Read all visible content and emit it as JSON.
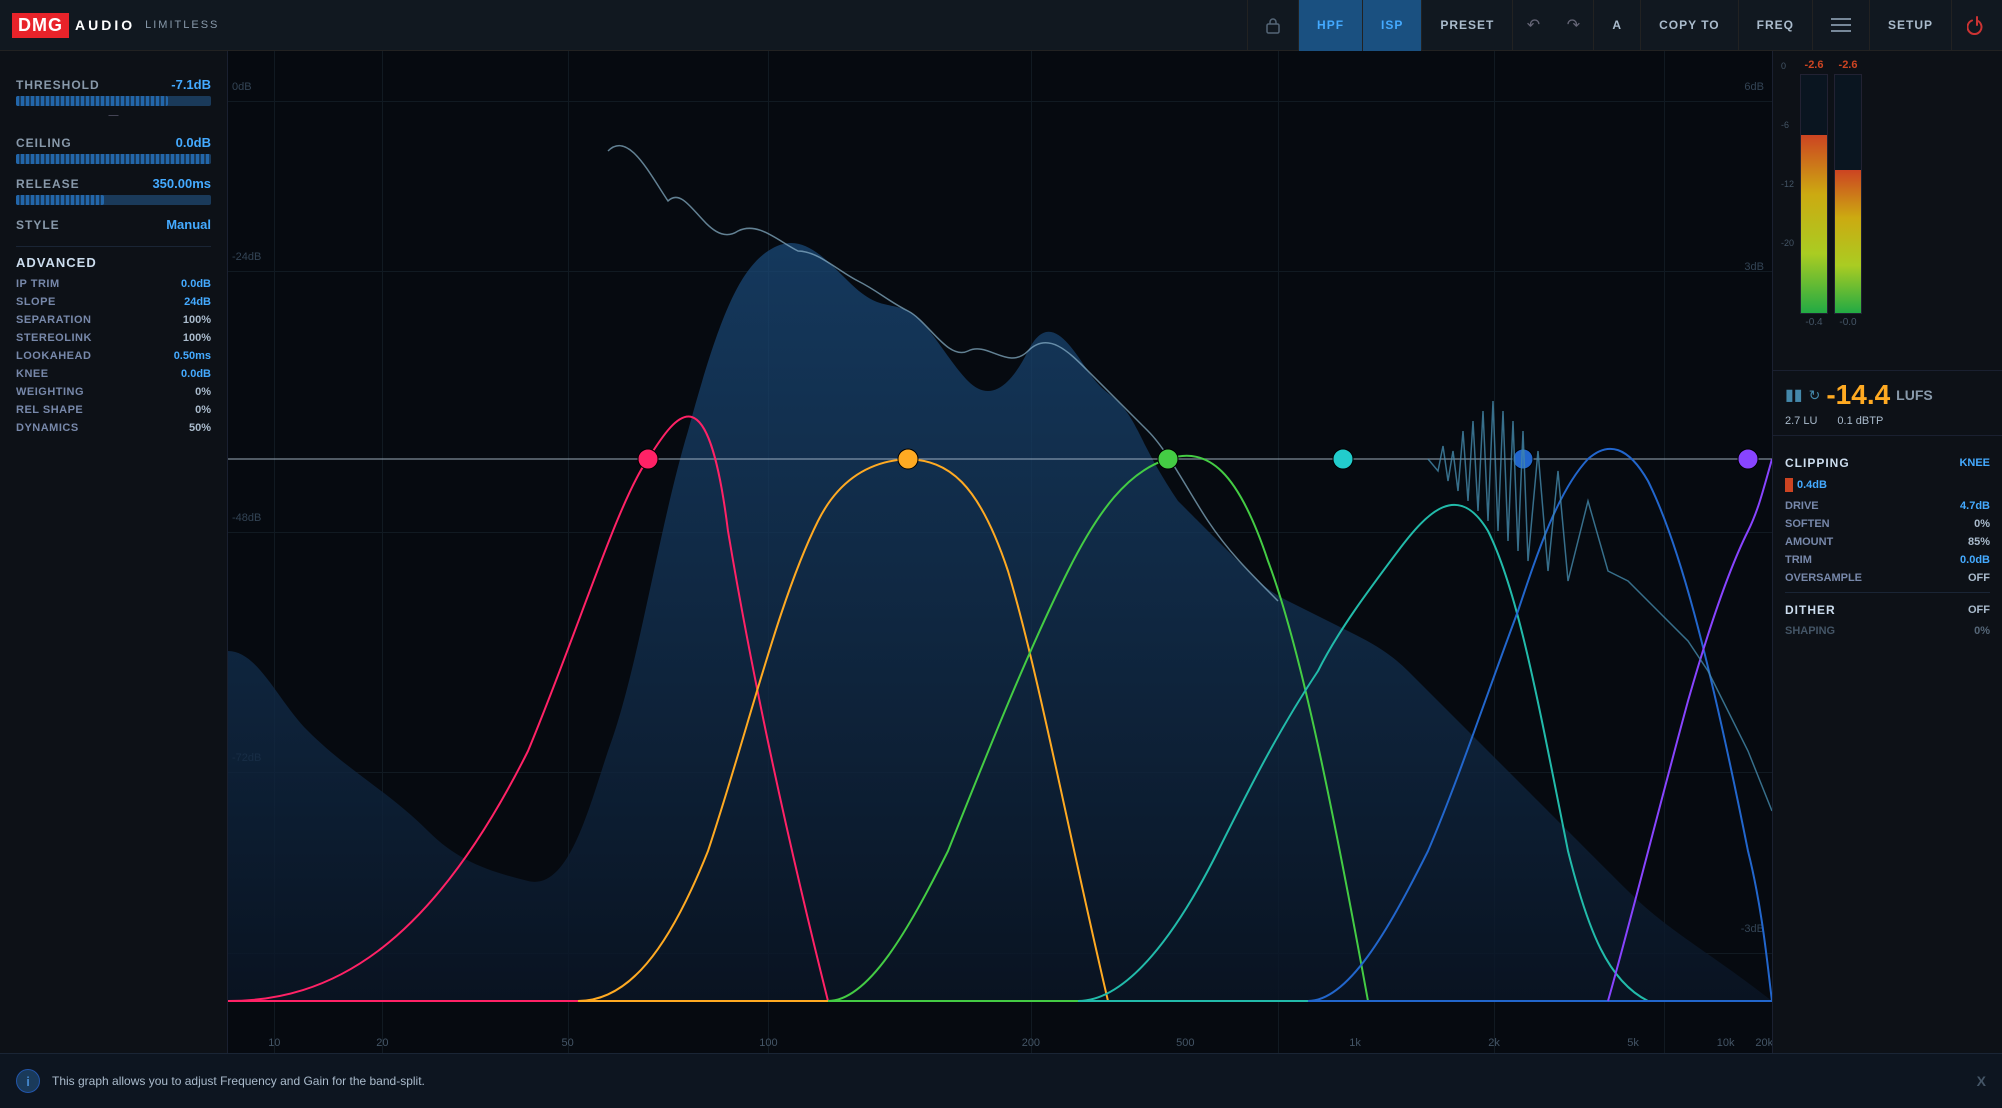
{
  "topbar": {
    "logo_dmg": "DMG",
    "logo_audio": "AUDIO",
    "logo_limitless": "LIMITLESS",
    "btn_hpf": "HPF",
    "btn_isp": "ISP",
    "btn_preset": "PRESET",
    "btn_a": "A",
    "btn_copy_to": "COPY TO",
    "btn_freq": "FREQ",
    "btn_setup": "SETUP"
  },
  "left": {
    "threshold_label": "THRESHOLD",
    "threshold_value": "-7.1dB",
    "ceiling_label": "CEILING",
    "ceiling_value": "0.0dB",
    "release_label": "RELEASE",
    "release_value": "350.00ms",
    "style_label": "STYLE",
    "style_value": "Manual",
    "advanced_title": "ADVANCED",
    "ip_trim_label": "IP TRIM",
    "ip_trim_value": "0.0dB",
    "slope_label": "SLOPE",
    "slope_value": "24dB",
    "separation_label": "SEPARATION",
    "separation_value": "100%",
    "stereolink_label": "STEREOLINK",
    "stereolink_value": "100%",
    "lookahead_label": "LOOKAHEAD",
    "lookahead_value": "0.50ms",
    "knee_label": "KNEE",
    "knee_value": "0.0dB",
    "weighting_label": "WEIGHTING",
    "weighting_value": "0%",
    "rel_shape_label": "REL SHAPE",
    "rel_shape_value": "0%",
    "dynamics_label": "DYNAMICS",
    "dynamics_value": "50%"
  },
  "spectrum": {
    "db_labels": [
      "0dB",
      "-24dB",
      "-48dB",
      "-72dB"
    ],
    "db_right_labels": [
      "6dB",
      "3dB",
      "-3dB"
    ],
    "freq_labels": [
      "10",
      "20",
      "50",
      "100",
      "200",
      "500",
      "1k",
      "2k",
      "5k",
      "10k",
      "20k"
    ]
  },
  "meters": {
    "left_label": "-2.6",
    "right_label": "-2.6",
    "scale": [
      "0",
      "-6",
      "-12",
      "-20"
    ],
    "left_peak": "-0.4",
    "right_peak": "-0.0"
  },
  "lufs": {
    "value": "-14.4",
    "unit": "LUFS",
    "lu_label": "LU",
    "lu_value": "2.7",
    "dbtp_label": "dBTP",
    "dbtp_value": "0.1"
  },
  "right_controls": {
    "clipping_title": "CLIPPING",
    "knee_link": "KNEE",
    "clipping_bar_value": "0.4dB",
    "drive_label": "DRIVE",
    "drive_value": "4.7dB",
    "soften_label": "SOFTEN",
    "soften_value": "0%",
    "amount_label": "AMOUNT",
    "amount_value": "85%",
    "trim_label": "TRIM",
    "trim_value": "0.0dB",
    "oversample_label": "OVERSAMPLE",
    "oversample_value": "OFF",
    "dither_title": "DITHER",
    "dither_value": "OFF",
    "shaping_label": "SHAPING",
    "shaping_value": "0%"
  },
  "bottom_bar": {
    "info_letter": "i",
    "info_text": "This graph allows you to adjust Frequency and Gain for the band-split.",
    "close_label": "X"
  }
}
